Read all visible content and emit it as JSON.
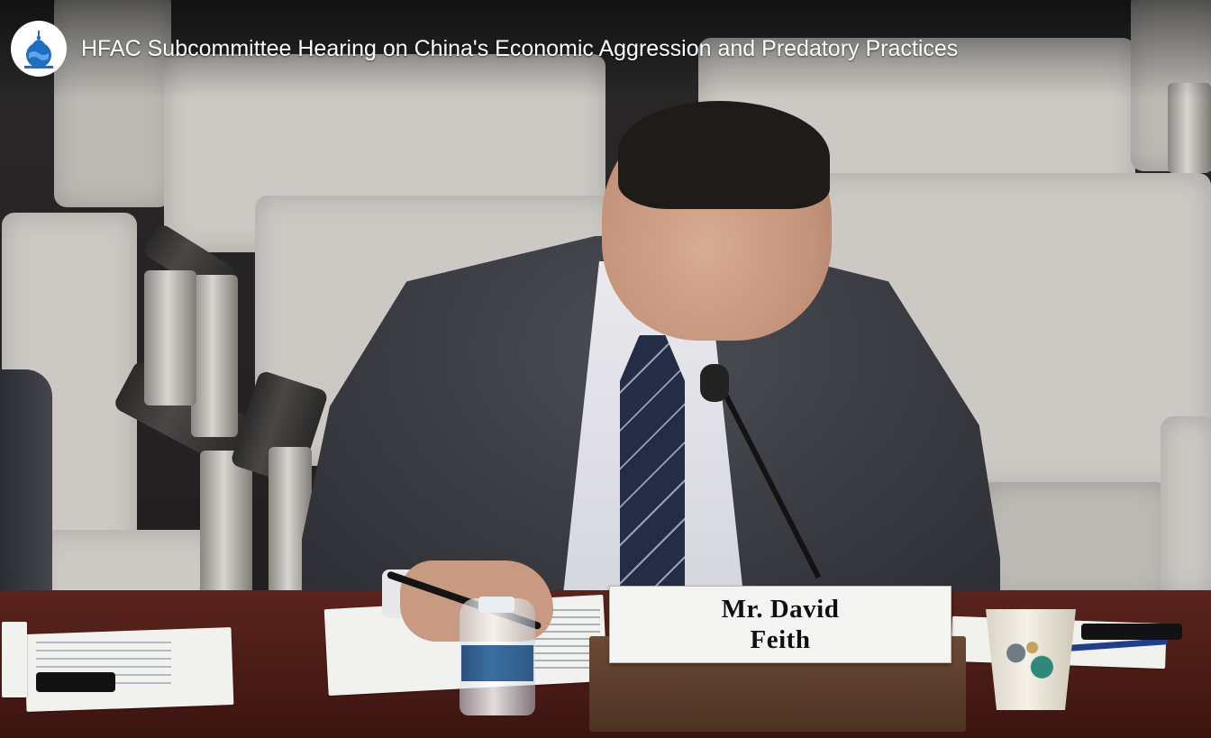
{
  "video": {
    "title": "HFAC Subcommittee Hearing on China's Economic Aggression and Predatory Practices",
    "channel_logo_icon": "capitol-dome-globe-icon"
  },
  "scene": {
    "nameplate": {
      "line1": "Mr. David",
      "line2": "Feith"
    }
  },
  "colors": {
    "title_text": "#ffffff",
    "logo_background": "#ffffff",
    "logo_accent": "#1d6fc4",
    "table": "#4a1b16",
    "chair": "#ccc9c4"
  }
}
